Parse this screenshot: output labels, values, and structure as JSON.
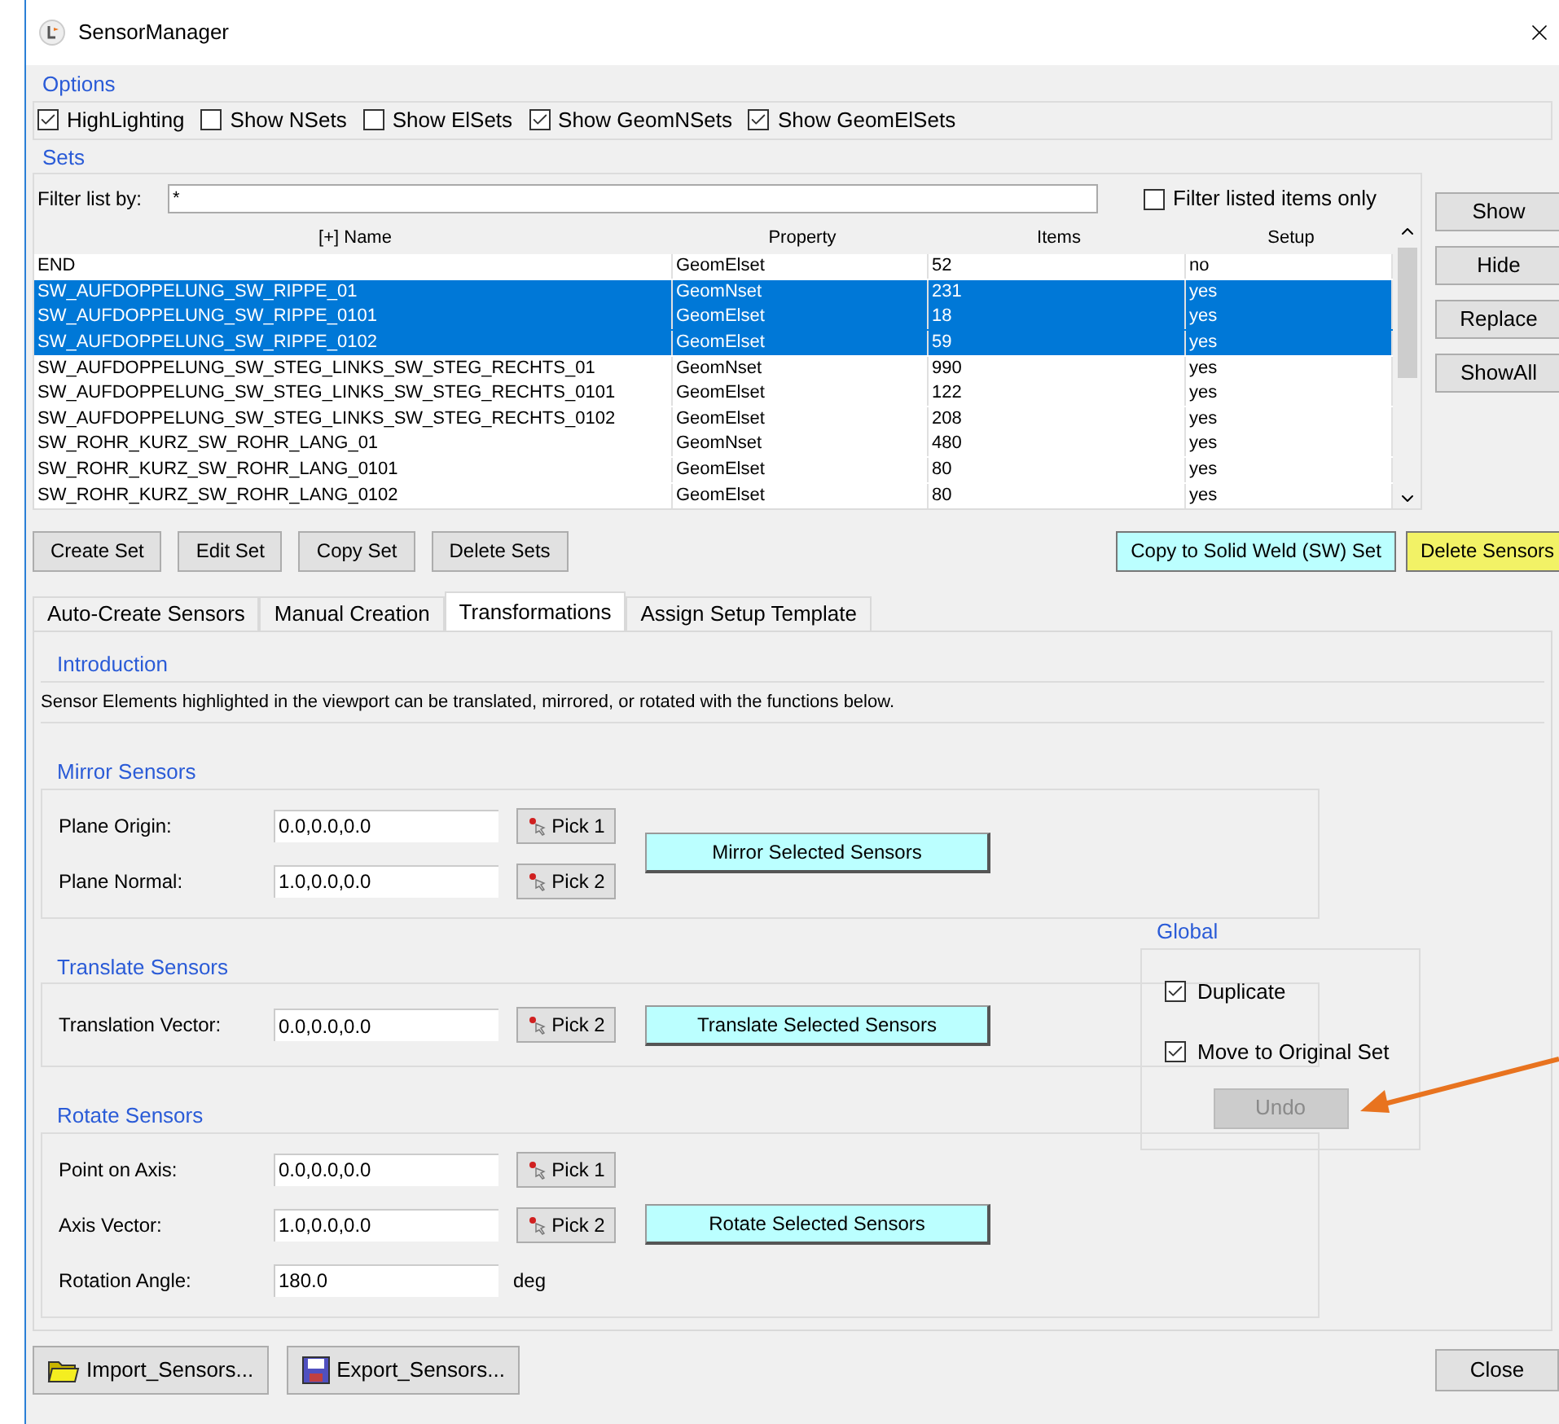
{
  "window": {
    "title": "SensorManager"
  },
  "options": {
    "title": "Options",
    "checkboxes": [
      {
        "label": "HighLighting",
        "checked": true
      },
      {
        "label": "Show NSets",
        "checked": false
      },
      {
        "label": "Show ElSets",
        "checked": false
      },
      {
        "label": "Show GeomNSets",
        "checked": true
      },
      {
        "label": "Show GeomElSets",
        "checked": true
      }
    ]
  },
  "sets": {
    "title": "Sets",
    "filter": {
      "label": "Filter list by:",
      "value": "*"
    },
    "filter_only": {
      "label": "Filter listed items only",
      "checked": false
    },
    "table": {
      "columns": [
        "[+] Name",
        "Property",
        "Items",
        "Setup"
      ],
      "rows": [
        {
          "cells": [
            "END",
            "GeomElset",
            "52",
            "no"
          ],
          "selected": false
        },
        {
          "cells": [
            "SW_AUFDOPPELUNG_SW_RIPPE_01",
            "GeomNset",
            "231",
            "yes"
          ],
          "selected": true
        },
        {
          "cells": [
            "SW_AUFDOPPELUNG_SW_RIPPE_0101",
            "GeomElset",
            "18",
            "yes"
          ],
          "selected": true
        },
        {
          "cells": [
            "SW_AUFDOPPELUNG_SW_RIPPE_0102",
            "GeomElset",
            "59",
            "yes"
          ],
          "selected": true
        },
        {
          "cells": [
            "SW_AUFDOPPELUNG_SW_STEG_LINKS_SW_STEG_RECHTS_01",
            "GeomNset",
            "990",
            "yes"
          ],
          "selected": false
        },
        {
          "cells": [
            "SW_AUFDOPPELUNG_SW_STEG_LINKS_SW_STEG_RECHTS_0101",
            "GeomElset",
            "122",
            "yes"
          ],
          "selected": false
        },
        {
          "cells": [
            "SW_AUFDOPPELUNG_SW_STEG_LINKS_SW_STEG_RECHTS_0102",
            "GeomElset",
            "208",
            "yes"
          ],
          "selected": false
        },
        {
          "cells": [
            "SW_ROHR_KURZ_SW_ROHR_LANG_01",
            "GeomNset",
            "480",
            "yes"
          ],
          "selected": false
        },
        {
          "cells": [
            "SW_ROHR_KURZ_SW_ROHR_LANG_0101",
            "GeomElset",
            "80",
            "yes"
          ],
          "selected": false
        },
        {
          "cells": [
            "SW_ROHR_KURZ_SW_ROHR_LANG_0102",
            "GeomElset",
            "80",
            "yes"
          ],
          "selected": false
        }
      ]
    },
    "side_buttons": [
      "Show",
      "Hide",
      "Replace",
      "ShowAll"
    ]
  },
  "set_buttons": [
    "Create Set",
    "Edit Set",
    "Copy Set",
    "Delete Sets"
  ],
  "action_buttons": [
    {
      "label": "Copy to Solid Weld (SW) Set",
      "color": "#bbffff"
    },
    {
      "label": "Delete Sensors",
      "color": "#f2f266"
    }
  ],
  "tabs": [
    {
      "label": "Auto-Create Sensors",
      "selected": false
    },
    {
      "label": "Manual Creation",
      "selected": false
    },
    {
      "label": "Transformations",
      "selected": true
    },
    {
      "label": "Assign Setup Template",
      "selected": false
    }
  ],
  "introduction": {
    "title": "Introduction",
    "text": "Sensor Elements highlighted in the viewport can be translated, mirrored, or rotated with the functions below."
  },
  "groups": [
    {
      "title": "Mirror Sensors",
      "action": "Mirror Selected Sensors",
      "rows": [
        {
          "label": "Plane Origin:",
          "value": "0.0,0.0,0.0",
          "pick": "Pick 1"
        },
        {
          "label": "Plane Normal:",
          "value": "1.0,0.0,0.0",
          "pick": "Pick 2"
        }
      ]
    },
    {
      "title": "Translate Sensors",
      "action": "Translate Selected Sensors",
      "rows": [
        {
          "label": "Translation Vector:",
          "value": "0.0,0.0,0.0",
          "pick": "Pick 2"
        }
      ]
    },
    {
      "title": "Rotate Sensors",
      "action": "Rotate Selected Sensors",
      "rows": [
        {
          "label": "Point on Axis:",
          "value": "0.0,0.0,0.0",
          "pick": "Pick 1"
        },
        {
          "label": "Axis Vector:",
          "value": "1.0,0.0,0.0",
          "pick": "Pick 2"
        },
        {
          "label": "Rotation Angle:",
          "value": "180.0",
          "unit": "deg"
        }
      ]
    }
  ],
  "global": {
    "title": "Global",
    "checkboxes": [
      {
        "label": "Duplicate",
        "checked": true
      },
      {
        "label": "Move to Original Set",
        "checked": true
      }
    ],
    "undo": {
      "label": "Undo",
      "disabled": true
    }
  },
  "footer": {
    "import": "Import_Sensors...",
    "export": "Export_Sensors...",
    "close": "Close"
  }
}
